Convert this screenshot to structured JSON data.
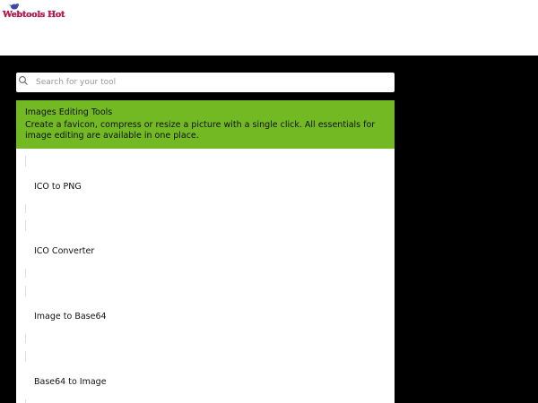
{
  "brand": {
    "logo_text": "Webtools Hot",
    "logo_color": "#d4145a"
  },
  "search": {
    "placeholder": "Search for your tool",
    "value": "",
    "icon": "search-icon"
  },
  "category": {
    "title": "Images Editing Tools",
    "description": "Create a favicon, compress or resize a picture with a single click. All essentials for image editing are available in one place.",
    "header_color": "#73b923",
    "tools": [
      {
        "label": "ICO to PNG"
      },
      {
        "label": "ICO Converter"
      },
      {
        "label": "Image to Base64"
      },
      {
        "label": "Base64 to Image"
      }
    ]
  }
}
